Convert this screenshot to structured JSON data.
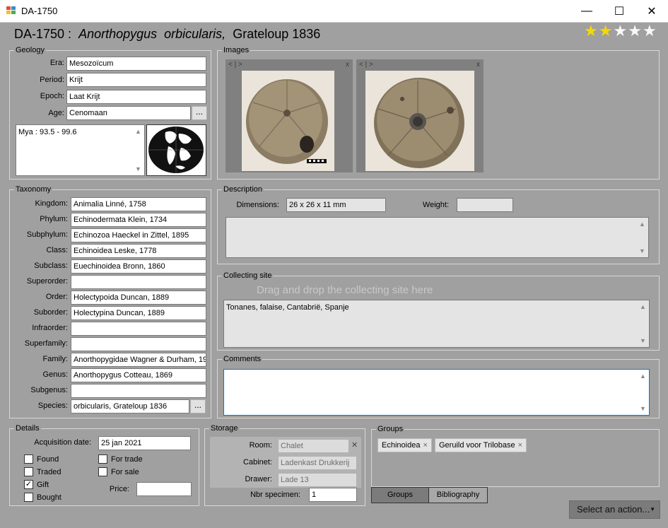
{
  "window": {
    "title": "DA-1750",
    "minimize_glyph": "—",
    "maximize_glyph": "☐",
    "close_glyph": "✕"
  },
  "heading": {
    "code": "DA-1750 :",
    "genus": "Anorthopygus",
    "species": "orbicularis,",
    "author": "Grateloup 1836"
  },
  "rating": {
    "value": 2,
    "max": 5,
    "star_glyph": "★",
    "empty_glyph": "☆"
  },
  "geology": {
    "title": "Geology",
    "fields": [
      {
        "label": "Era:",
        "value": "Mesozoïcum"
      },
      {
        "label": "Period:",
        "value": "Krijt"
      },
      {
        "label": "Epoch:",
        "value": "Laat Krijt"
      },
      {
        "label": "Age:",
        "value": "Cenomaan"
      }
    ],
    "age_button": "...",
    "mya_text": "Mya : 93.5 - 99.6"
  },
  "images": {
    "title": "Images",
    "nav_text": "< | >",
    "close_glyph": "x"
  },
  "taxonomy": {
    "title": "Taxonomy",
    "fields": [
      {
        "label": "Kingdom:",
        "value": "Animalia Linné, 1758"
      },
      {
        "label": "Phylum:",
        "value": "Echinodermata Klein, 1734"
      },
      {
        "label": "Subphylum:",
        "value": "Echinozoa Haeckel in Zittel, 1895"
      },
      {
        "label": "Class:",
        "value": "Echinoidea Leske, 1778"
      },
      {
        "label": "Subclass:",
        "value": "Euechinoidea Bronn, 1860"
      },
      {
        "label": "Superorder:",
        "value": ""
      },
      {
        "label": "Order:",
        "value": "Holectypoida Duncan, 1889"
      },
      {
        "label": "Suborder:",
        "value": "Holectypina Duncan, 1889"
      },
      {
        "label": "Infraorder:",
        "value": ""
      },
      {
        "label": "Superfamily:",
        "value": ""
      },
      {
        "label": "Family:",
        "value": "Anorthopygidae Wagner & Durham, 196"
      },
      {
        "label": "Genus:",
        "value": "Anorthopygus Cotteau, 1869"
      },
      {
        "label": "Subgenus:",
        "value": ""
      },
      {
        "label": "Species:",
        "value": "orbicularis, Grateloup 1836"
      }
    ],
    "species_button": "..."
  },
  "description": {
    "title": "Description",
    "dimensions_label": "Dimensions:",
    "dimensions_value": "26 x 26 x 11 mm",
    "weight_label": "Weight:",
    "weight_value": "",
    "text": ""
  },
  "collecting_site": {
    "title": "Collecting site",
    "drop_hint": "Drag and drop the collecting site here",
    "text": "Tonanes, falaise, Cantabrië, Spanje"
  },
  "comments": {
    "title": "Comments",
    "text": ""
  },
  "details": {
    "title": "Details",
    "acq_label": "Acquisition date:",
    "acq_value": "25 jan 2021",
    "checks": [
      {
        "label": "Found",
        "checked": false
      },
      {
        "label": "Traded",
        "checked": false
      },
      {
        "label": "Gift",
        "checked": true
      },
      {
        "label": "Bought",
        "checked": false
      },
      {
        "label": "For trade",
        "checked": false
      },
      {
        "label": "For sale",
        "checked": false
      }
    ],
    "check_mark": "✓",
    "price_label": "Price:",
    "price_value": ""
  },
  "storage": {
    "title": "Storage",
    "room_label": "Room:",
    "room_value": "Chalet",
    "cabinet_label": "Cabinet:",
    "cabinet_value": "Ladenkast Drukkerij",
    "drawer_label": "Drawer:",
    "drawer_value": "Lade 13",
    "nbr_label": "Nbr specimen:",
    "nbr_value": "1",
    "clear_glyph": "✕"
  },
  "groups": {
    "title": "Groups",
    "tags": [
      "Echinoidea",
      "Geruild voor Trilobase"
    ],
    "tag_remove": "×",
    "tabs": [
      "Groups",
      "Bibliography"
    ]
  },
  "action": {
    "label": "Select an action...",
    "caret": "▼"
  },
  "colors": {
    "background": "#a0a0a0",
    "star": "#f5d800",
    "comments_border": "#0078d7"
  }
}
